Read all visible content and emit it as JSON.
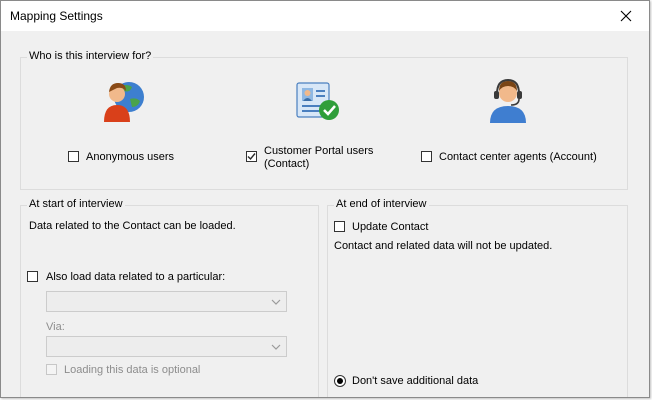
{
  "window": {
    "title": "Mapping Settings"
  },
  "who_group": {
    "legend": "Who is this interview for?",
    "options": [
      {
        "label": "Anonymous users",
        "checked": false,
        "icon": "globe-user-icon"
      },
      {
        "label_line1": "Customer Portal users",
        "label_line2": "(Contact)",
        "checked": true,
        "icon": "contact-card-check-icon"
      },
      {
        "label": "Contact center agents (Account)",
        "checked": false,
        "icon": "headset-agent-icon"
      }
    ]
  },
  "start_group": {
    "legend": "At start of interview",
    "description": "Data related to the Contact can be loaded.",
    "also_load_label": "Also load data related to a particular:",
    "also_load_checked": false,
    "via_label": "Via:",
    "optional_label": "Loading this data is optional",
    "optional_checked": false
  },
  "end_group": {
    "legend": "At end of interview",
    "update_label": "Update Contact",
    "update_checked": false,
    "description": "Contact and related data will not be updated.",
    "dont_save_label": "Don't save additional data",
    "dont_save_selected": true
  },
  "colors": {
    "window_bg": "#f0f0f0",
    "titlebar_bg": "#ffffff",
    "checkmark": "#2a2a2a",
    "disabled_text": "#8d8d8d"
  }
}
